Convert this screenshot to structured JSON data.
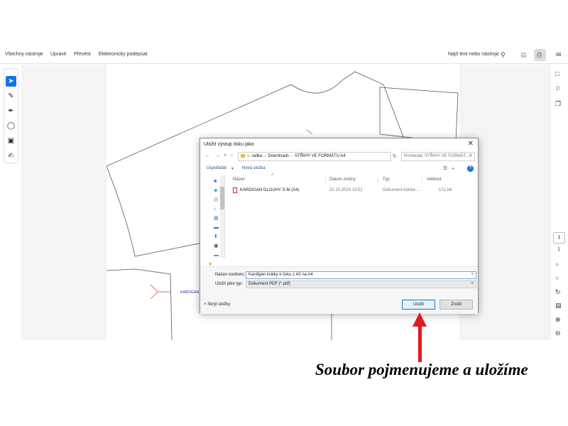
{
  "toolbar": {
    "menu": [
      "Všechny nástroje",
      "Upravit",
      "Převést",
      "Elektronicky podepsat"
    ],
    "find_placeholder": "Najít text nebo nástroje"
  },
  "pagination": {
    "current_page": "1",
    "total_pages": "1"
  },
  "document": {
    "pattern_labels": [
      "KARDIGAN KRÁTKY"
    ]
  },
  "dialog": {
    "title": "Uložit výstup tisku jako",
    "breadcrumb": [
      "radka",
      "Downloads",
      "STŘIHY VE FORMÁTU A4"
    ],
    "search_placeholder": "Prohledat: STŘIHY VE FORMÁT...",
    "organize_label": "Uspořádat",
    "new_folder_label": "Nová složka",
    "columns": {
      "name": "Název",
      "date": "Datum změny",
      "type": "Typ",
      "size": "Velikost"
    },
    "files": [
      {
        "name": "KARDIGAN DLOUHY S-M (A4)",
        "date": "20.10.2024 13:52",
        "type": "Dokument Adobe ...",
        "size": "121 kB"
      }
    ],
    "filename_label": "Název souboru:",
    "filename_value": "Kardigán krátky k tisku z A0 na A4",
    "savetype_label": "Uložit jako typ:",
    "savetype_value": "Dokument PDF (*.pdf)",
    "hide_folders_label": "Skrýt složky",
    "save_label": "Uložit",
    "cancel_label": "Zrušit"
  },
  "annotation": {
    "caption": "Soubor pojmenujeme a uložíme",
    "color": "#e0191e"
  },
  "colors": {
    "accent": "#1473e6",
    "dialog_button": "#1a6fd1"
  }
}
